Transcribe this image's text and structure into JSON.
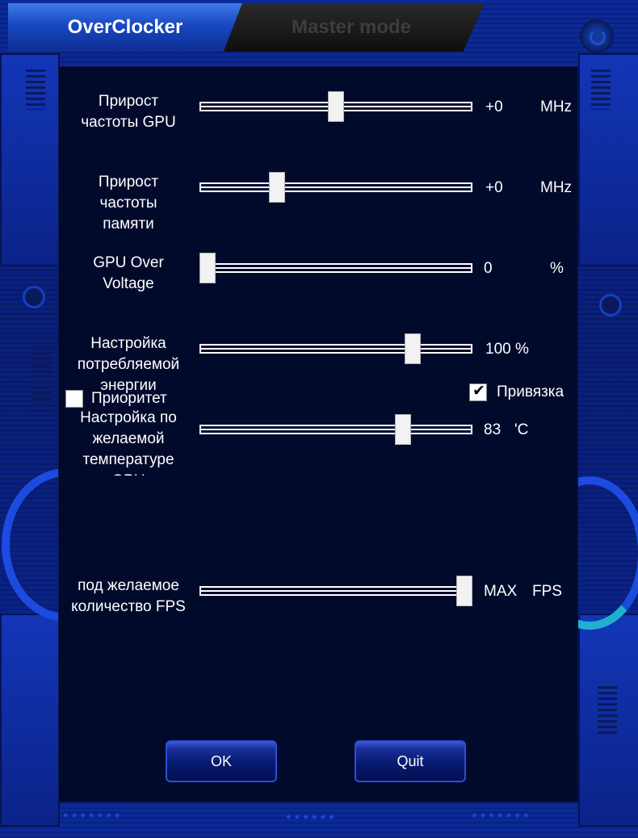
{
  "tabs": [
    {
      "label": "OverClocker",
      "active": true
    },
    {
      "label": "Master mode",
      "active": false
    }
  ],
  "sliders": [
    {
      "id": "gpu-clock",
      "label": "Прирост\nчастоты GPU",
      "value": "+0",
      "unit": "MHz",
      "fraction": 0.5
    },
    {
      "id": "mem-clock",
      "label": "Прирост\nчастоты\nпамяти",
      "value": "+0",
      "unit": "MHz",
      "fraction": 0.27
    },
    {
      "id": "voltage",
      "label": "GPU Over\nVoltage",
      "value": "0",
      "unit": "%",
      "fraction": 0.0
    },
    {
      "id": "power",
      "label": "Настройка\nпотребляемой\nэнергии",
      "value": "100 %",
      "unit": "",
      "fraction": 0.8
    },
    {
      "id": "temp",
      "label": "Настройка по\nжелаемой\nтемпературе\nGPU",
      "value": "83",
      "unit": "'C",
      "fraction": 0.76
    },
    {
      "id": "fps",
      "label": "под желаемое\nколичество FPS",
      "value": "MAX",
      "unit": "FPS",
      "fraction": 1.0
    }
  ],
  "checkboxes": {
    "priority": {
      "label": "Приоритет",
      "checked": false
    },
    "link": {
      "label": "Привязка",
      "checked": true
    }
  },
  "buttons": {
    "ok": "OK",
    "quit": "Quit"
  },
  "colors": {
    "accent": "#1848c2",
    "panel": "#020a2c",
    "frame": "#0b2a9a"
  }
}
